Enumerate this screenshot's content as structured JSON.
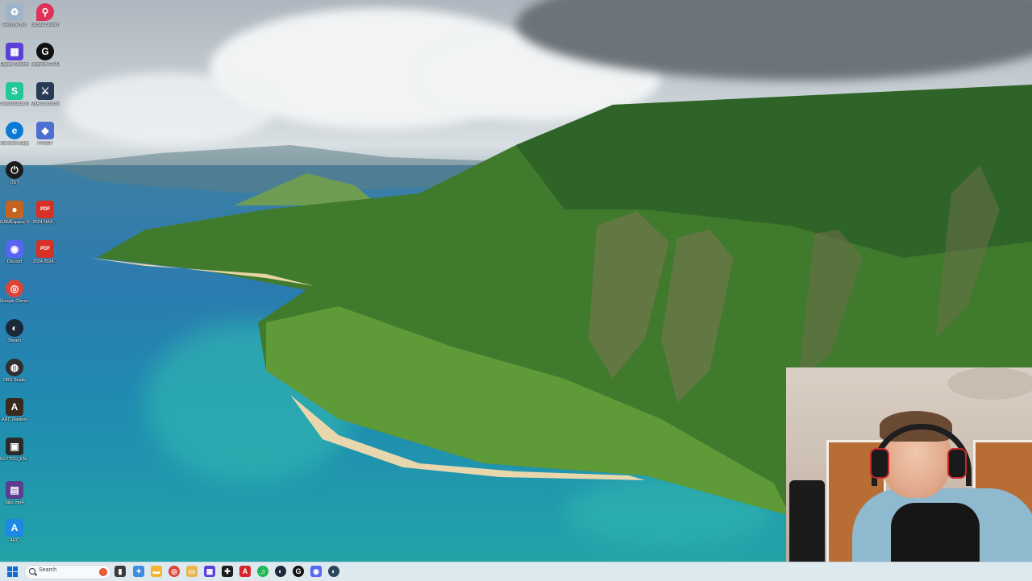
{
  "desktop": {
    "icons": [
      {
        "label": "Recycle Bin",
        "icon": "recycle-bin-icon",
        "glyph": "♻",
        "color": "#9fb4c8"
      },
      {
        "label": "Elgato Stream Deck",
        "icon": "stream-deck-icon",
        "glyph": "▦",
        "color": "#5b3fd6"
      },
      {
        "label": "StreamLabs Mod Menu",
        "icon": "streamlabs-icon",
        "glyph": "S",
        "color": "#20c997"
      },
      {
        "label": "Microsoft Edge",
        "icon": "edge-icon",
        "glyph": "e",
        "color": "#0c7bd6"
      },
      {
        "label": "OUT",
        "icon": "power-app-icon",
        "glyph": "⏻",
        "color": "#1b1b1b"
      },
      {
        "label": "GAMEspace Shortcut",
        "icon": "game-shortcut-icon",
        "glyph": "●",
        "color": "#c4651f"
      },
      {
        "label": "Discord",
        "icon": "discord-icon",
        "glyph": "◉",
        "color": "#5865f2"
      },
      {
        "label": "Google Chrome",
        "icon": "chrome-icon",
        "glyph": "◎",
        "color": "#db4437"
      },
      {
        "label": "Steam",
        "icon": "steam-icon",
        "glyph": "◐",
        "color": "#1b2838"
      },
      {
        "label": "OBS Studio",
        "icon": "obs-icon",
        "glyph": "◍",
        "color": "#302e31"
      },
      {
        "label": "ARC Raiders",
        "icon": "arc-raiders-icon",
        "glyph": "A",
        "color": "#3a2a1e"
      },
      {
        "label": "GLYTCH_EN... (1).webm",
        "icon": "video-file-icon",
        "glyph": "▣",
        "color": "#2b2b2b"
      },
      {
        "label": "tabc.mp4",
        "icon": "video-file-icon",
        "glyph": "▤",
        "color": "#5d3d8f"
      },
      {
        "label": "ARC",
        "icon": "arc-icon",
        "glyph": "A",
        "color": "#1e88e5"
      },
      {
        "label": "Locate Stream",
        "icon": "location-icon",
        "glyph": "⚲",
        "color": "#e0315a"
      },
      {
        "label": "Logitech G HUB",
        "icon": "logitech-icon",
        "glyph": "G",
        "color": "#111111"
      },
      {
        "label": "MyAlt Launcher",
        "icon": "launcher-icon",
        "glyph": "⚔",
        "color": "#283a56"
      },
      {
        "label": "PVSRF",
        "icon": "pvsrf-icon",
        "glyph": "◆",
        "color": "#4c6fd1"
      },
      {
        "label": "2024 NAS ...",
        "icon": "pdf-icon",
        "glyph": "PDF",
        "color": "#d93025"
      },
      {
        "label": "2024 2024...",
        "icon": "pdf-icon",
        "glyph": "PDF",
        "color": "#d93025"
      }
    ]
  },
  "taskbar": {
    "search_placeholder": "Search",
    "apps": [
      {
        "icon": "desktop-icon",
        "glyph": "▮",
        "color": "#3a3a3a"
      },
      {
        "icon": "copilot-icon",
        "glyph": "✦",
        "color": "#3b8de0"
      },
      {
        "icon": "file-explorer-icon",
        "glyph": "▬",
        "color": "#f2b632"
      },
      {
        "icon": "chrome-icon",
        "glyph": "◎",
        "color": "#db4437"
      },
      {
        "icon": "folder-icon",
        "glyph": "▭",
        "color": "#e8b64c"
      },
      {
        "icon": "stream-deck-icon",
        "glyph": "▦",
        "color": "#5b3fd6"
      },
      {
        "icon": "gaming-app-icon",
        "glyph": "✚",
        "color": "#1c1c1c"
      },
      {
        "icon": "adobe-icon",
        "glyph": "A",
        "color": "#d4252d"
      },
      {
        "icon": "spotify-icon",
        "glyph": "♫",
        "color": "#1db954"
      },
      {
        "icon": "steam-icon",
        "glyph": "◐",
        "color": "#1b2838"
      },
      {
        "icon": "logitech-icon",
        "glyph": "G",
        "color": "#111111"
      },
      {
        "icon": "discord-icon",
        "glyph": "◉",
        "color": "#5865f2"
      },
      {
        "icon": "steam-icon",
        "glyph": "◐",
        "color": "#2a475e"
      }
    ]
  }
}
